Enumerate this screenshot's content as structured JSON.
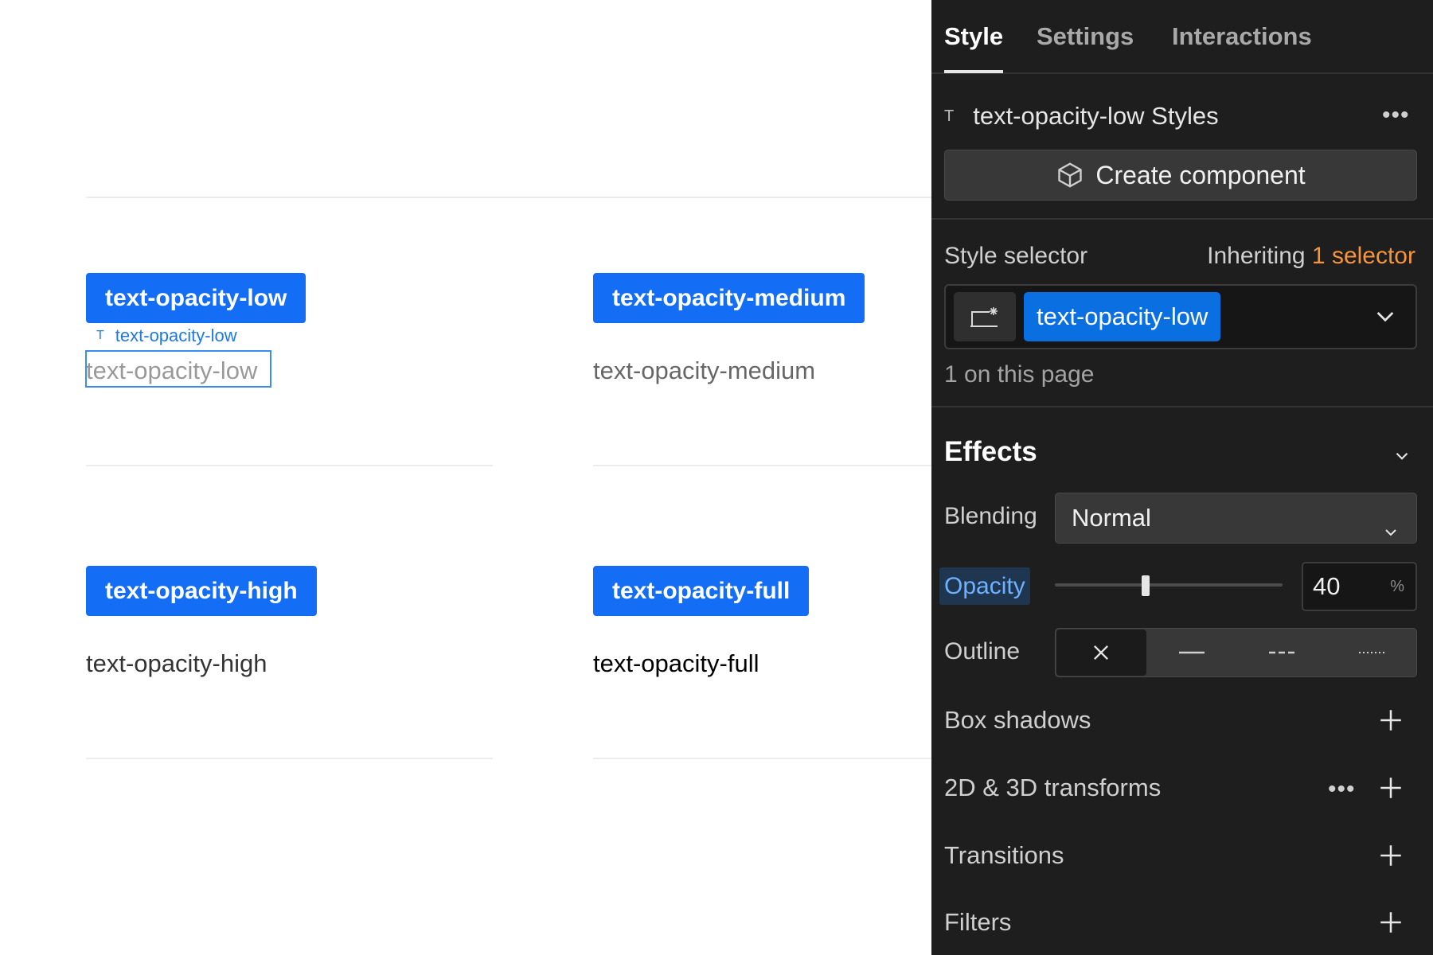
{
  "canvas": {
    "cards": [
      {
        "tag": "text-opacity-low",
        "sample": "text-opacity-low"
      },
      {
        "tag": "text-opacity-medium",
        "sample": "text-opacity-medium"
      },
      {
        "tag": "text-opacity-high",
        "sample": "text-opacity-high"
      },
      {
        "tag": "text-opacity-full",
        "sample": "text-opacity-full"
      }
    ],
    "selected_label": "text-opacity-low",
    "selected_label_icon": "text-type-icon"
  },
  "panel": {
    "tabs": [
      {
        "label": "Style",
        "active": true
      },
      {
        "label": "Settings",
        "active": false
      },
      {
        "label": "Interactions",
        "active": false
      }
    ],
    "element_title": "text-opacity-low Styles",
    "element_icon": "T",
    "create_component_label": "Create component",
    "style_selector": {
      "label": "Style selector",
      "inheriting_prefix": "Inheriting",
      "inheriting_count": "1 selector",
      "selector_pill": "text-opacity-low",
      "count_text": "1 on this page"
    },
    "effects": {
      "title": "Effects",
      "blending_label": "Blending",
      "blending_value": "Normal",
      "opacity_label": "Opacity",
      "opacity_value": "40",
      "opacity_unit": "%",
      "opacity_fraction": 0.4,
      "outline_label": "Outline",
      "outline_options": [
        "none",
        "solid",
        "dashed",
        "dotted"
      ],
      "outline_selected": "none",
      "box_shadows_label": "Box shadows",
      "transforms_label": "2D & 3D transforms",
      "transitions_label": "Transitions",
      "filters_label": "Filters"
    },
    "colors": {
      "accent_blue": "#146ef5",
      "inherit_orange": "#f7953b",
      "panel_bg": "#1e1e1e"
    }
  }
}
